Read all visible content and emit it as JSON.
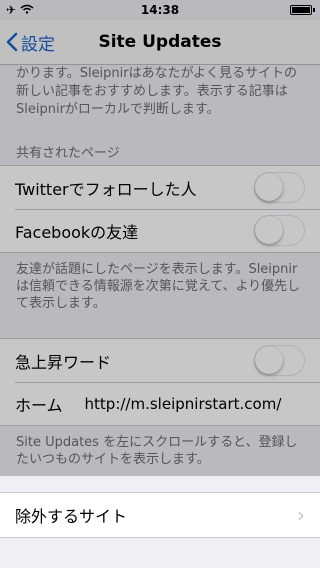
{
  "status_bar": {
    "time": "14:38"
  },
  "nav": {
    "back_label": "設定",
    "title": "Site Updates"
  },
  "top_note": "かります。Sleipnirはあなたがよく見るサイトの新しい記事をおすすめします。表示する記事はSleipnirがローカルで判断します。",
  "shared_section": {
    "header": "共有されたページ",
    "rows": [
      {
        "label": "Twitterでフォローした人",
        "toggle_on": false
      },
      {
        "label": "Facebookの友達",
        "toggle_on": false
      }
    ],
    "footer": "友達が話題にしたページを表示します。Sleipnirは信頼できる情報源を次第に覚えて、より優先して表示します。"
  },
  "trend_section": {
    "toggle_row": {
      "label": "急上昇ワード",
      "toggle_on": false
    },
    "home_row": {
      "label": "ホーム",
      "value": "http://m.sleipnirstart.com/"
    },
    "footer": "Site Updates を左にスクロールすると、登録したいつものサイトを表示します。"
  },
  "exclude_row": {
    "label": "除外するサイト"
  }
}
